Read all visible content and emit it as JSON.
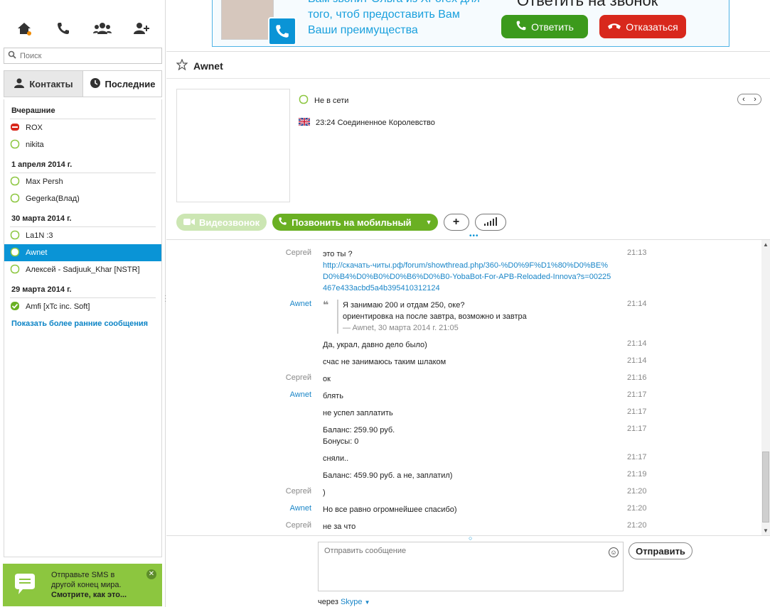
{
  "search": {
    "placeholder": "Поиск"
  },
  "tabs": {
    "contacts": "Контакты",
    "recent": "Последние"
  },
  "groups": [
    {
      "label": "Вчерашние"
    },
    {
      "label": "1 апреля 2014 г."
    },
    {
      "label": "30 марта 2014 г."
    },
    {
      "label": "29 марта 2014 г."
    }
  ],
  "contacts": [
    {
      "name": "ROX",
      "status": "red"
    },
    {
      "name": "nikita",
      "status": "offline"
    },
    {
      "name": "Max Persh",
      "status": "offline"
    },
    {
      "name": "Gegerka(Влад)",
      "status": "offline"
    },
    {
      "name": "La1N :3",
      "status": "offline"
    },
    {
      "name": "Awnet",
      "status": "offline",
      "selected": true
    },
    {
      "name": "Алексей - Sadjuuk_Khar [NSTR]",
      "status": "offline"
    },
    {
      "name": "Amfi [xTc inc. Soft]",
      "status": "online"
    }
  ],
  "show_more": "Показать более ранние сообщения",
  "promo": {
    "line1": "Отправьте SMS в",
    "line2": "другой конец мира.",
    "link": "Смотрите, как это..."
  },
  "ad": {
    "line1": "Вам звонит Ольга из XForex для",
    "line2": "того, чтоб предоставить Вам",
    "line3": "Ваши преимущества",
    "headline": "Ответить на звонок",
    "answer": "Ответить",
    "reject": "Отказаться"
  },
  "conversation": {
    "title": "Awnet",
    "status": "Не в сети",
    "location": "23:24 Соединенное Королевство",
    "video_button": "Видеозвонок",
    "call_button": "Позвонить на мобильный"
  },
  "messages": [
    {
      "sender": "Сергей",
      "text": "это ты ?",
      "time": "21:13"
    },
    {
      "link": "http://скачать-читы.рф/forum/showthread.php/360-%D0%9F%D1%80%D0%BE%D0%B4%D0%B0%D0%B6%D0%B0-YobaBot-For-APB-Reloaded-Innova?s=00225467e433acbd5a4b395410312124"
    },
    {
      "sender": "Awnet",
      "quote1": "Я занимаю 200 и отдам 250, оке?",
      "quote2": "ориентировка на после завтра, возможно и завтра",
      "quote_src": "— Awnet, 30 марта 2014 г. 21:05",
      "time": "21:14"
    },
    {
      "sender": "",
      "text": "Да, украл, давно дело было)",
      "time": "21:14"
    },
    {
      "sender": "",
      "text": "счас не занимаюсь таким шлаком",
      "time": "21:14"
    },
    {
      "sender": "Сергей",
      "text": "ок",
      "time": "21:16"
    },
    {
      "sender": "Awnet",
      "text": "блять",
      "time": "21:17"
    },
    {
      "sender": "",
      "text": "не успел заплатить",
      "time": "21:17"
    },
    {
      "sender": "",
      "text": "Баланс: 259.90 руб.",
      "text2": "Бонусы: 0",
      "time": "21:17"
    },
    {
      "sender": "",
      "text": "сняли..",
      "time": "21:17"
    },
    {
      "sender": "",
      "text": "Баланс: 459.90 руб.  а не, заплатил)",
      "time": "21:19"
    },
    {
      "sender": "Сергей",
      "text": ")",
      "time": "21:20"
    },
    {
      "sender": "Awnet",
      "text": "Но все равно огромнейшее спасибо)",
      "time": "21:20"
    },
    {
      "sender": "Сергей",
      "text": "не за что",
      "time": "21:20"
    }
  ],
  "compose": {
    "placeholder": "Отправить сообщение",
    "send": "Отправить",
    "via": "через",
    "via_link": "Skype"
  },
  "colors": {
    "accent": "#0a94d6",
    "green": "#6ab023",
    "red": "#d8281c"
  }
}
